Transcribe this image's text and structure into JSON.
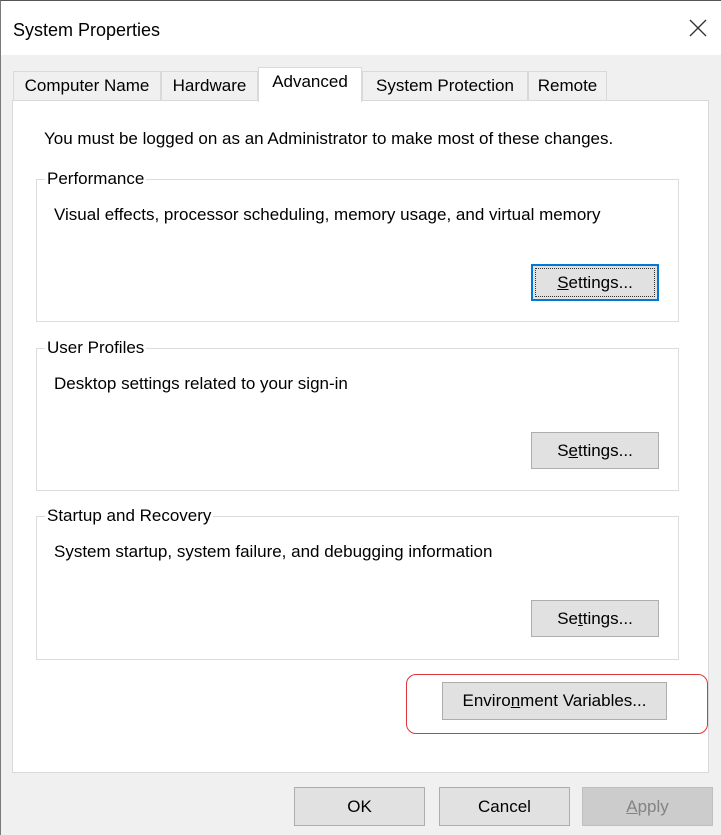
{
  "window": {
    "title": "System Properties",
    "close_icon": "close-icon"
  },
  "tabs": [
    {
      "label": "Computer Name",
      "active": false
    },
    {
      "label": "Hardware",
      "active": false
    },
    {
      "label": "Advanced",
      "active": true
    },
    {
      "label": "System Protection",
      "active": false
    },
    {
      "label": "Remote",
      "active": false
    }
  ],
  "advanced": {
    "notice": "You must be logged on as an Administrator to make most of these changes.",
    "groups": [
      {
        "legend": "Performance",
        "description": "Visual effects, processor scheduling, memory usage, and virtual memory",
        "button": {
          "pre": "",
          "mnemonic": "S",
          "post": "ettings...",
          "is_default": true
        }
      },
      {
        "legend": "User Profiles",
        "description": "Desktop settings related to your sign-in",
        "button": {
          "pre": "S",
          "mnemonic": "e",
          "post": "ttings...",
          "is_default": false
        }
      },
      {
        "legend": "Startup and Recovery",
        "description": "System startup, system failure, and debugging information",
        "button": {
          "pre": "Se",
          "mnemonic": "t",
          "post": "tings...",
          "is_default": false
        }
      }
    ],
    "env_button": {
      "pre": "Enviro",
      "mnemonic": "n",
      "post": "ment Variables...",
      "highlighted": true,
      "highlight_color": "#e0353a"
    }
  },
  "footer": {
    "ok": {
      "label": "OK"
    },
    "cancel": {
      "label": "Cancel"
    },
    "apply": {
      "pre": "",
      "mnemonic": "A",
      "post": "pply",
      "disabled": true
    }
  },
  "colors": {
    "accent": "#0078d7",
    "dialog_bg": "#f0f0f0",
    "button_bg": "#e1e1e1",
    "disabled_text": "#838383"
  }
}
